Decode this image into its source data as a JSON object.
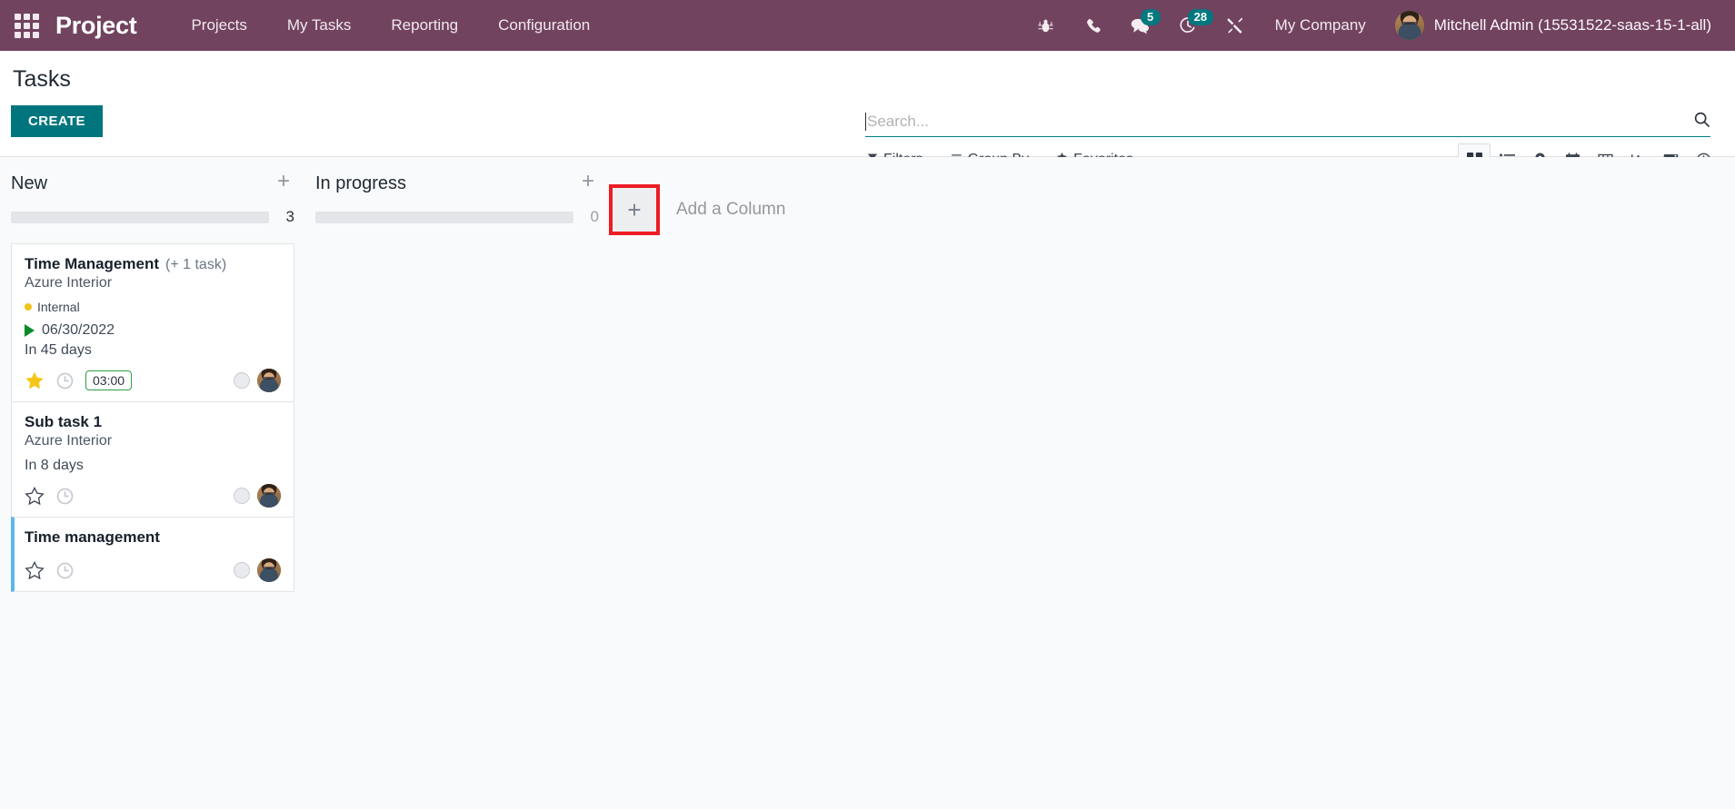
{
  "navbar": {
    "apps_icon": "apps-grid-icon",
    "brand": "Project",
    "menu": [
      {
        "label": "Projects"
      },
      {
        "label": "My Tasks"
      },
      {
        "label": "Reporting"
      },
      {
        "label": "Configuration"
      }
    ],
    "sys_icons": [
      {
        "name": "bug-icon",
        "badge": ""
      },
      {
        "name": "phone-icon",
        "badge": ""
      },
      {
        "name": "messages-icon",
        "badge": "5"
      },
      {
        "name": "activities-clock-icon",
        "badge": "28"
      },
      {
        "name": "tools-icon",
        "badge": ""
      }
    ],
    "company": "My Company",
    "user": "Mitchell Admin (15531522-saas-15-1-all)",
    "bg_color": "#71435f",
    "badge_color": "#00787f"
  },
  "control_panel": {
    "title": "Tasks",
    "create_label": "CREATE",
    "create_color": "#00757e",
    "search": {
      "value": "",
      "placeholder": "Search..."
    },
    "filters": [
      {
        "label": "Filters",
        "icon": "funnel-icon"
      },
      {
        "label": "Group By",
        "icon": "bars-icon"
      },
      {
        "label": "Favorites",
        "icon": "star-icon"
      }
    ],
    "views": [
      {
        "name": "kanban-view",
        "active": true
      },
      {
        "name": "list-view",
        "active": false
      },
      {
        "name": "map-view",
        "active": false
      },
      {
        "name": "calendar-view",
        "active": false
      },
      {
        "name": "pivot-view",
        "active": false
      },
      {
        "name": "graph-view",
        "active": false
      },
      {
        "name": "activity-view",
        "active": false
      },
      {
        "name": "timesheet-clock-view",
        "active": false
      }
    ]
  },
  "kanban": {
    "columns": [
      {
        "title": "New",
        "count": "3",
        "cards": [
          {
            "title": "Time Management",
            "subtasks": "(+ 1 task)",
            "project": "Azure Interior",
            "tag": "Internal",
            "tag_color": "#f0c419",
            "date": "06/30/2022",
            "deadline": "In 45 days",
            "starred": true,
            "timer": "03:00",
            "accent": ""
          },
          {
            "title": "Sub task 1",
            "subtasks": "",
            "project": "Azure Interior",
            "tag": "",
            "tag_color": "",
            "date": "",
            "deadline": "In 8 days",
            "starred": false,
            "timer": "",
            "accent": ""
          },
          {
            "title": "Time management",
            "subtasks": "",
            "project": "",
            "tag": "",
            "tag_color": "",
            "date": "",
            "deadline": "",
            "starred": false,
            "timer": "",
            "accent": "#5bb8e8"
          }
        ]
      },
      {
        "title": "In progress",
        "count": "0",
        "cards": []
      }
    ],
    "add_column": {
      "plus": "+",
      "label": "Add a Column",
      "highlight_color": "#ed1c24"
    }
  }
}
